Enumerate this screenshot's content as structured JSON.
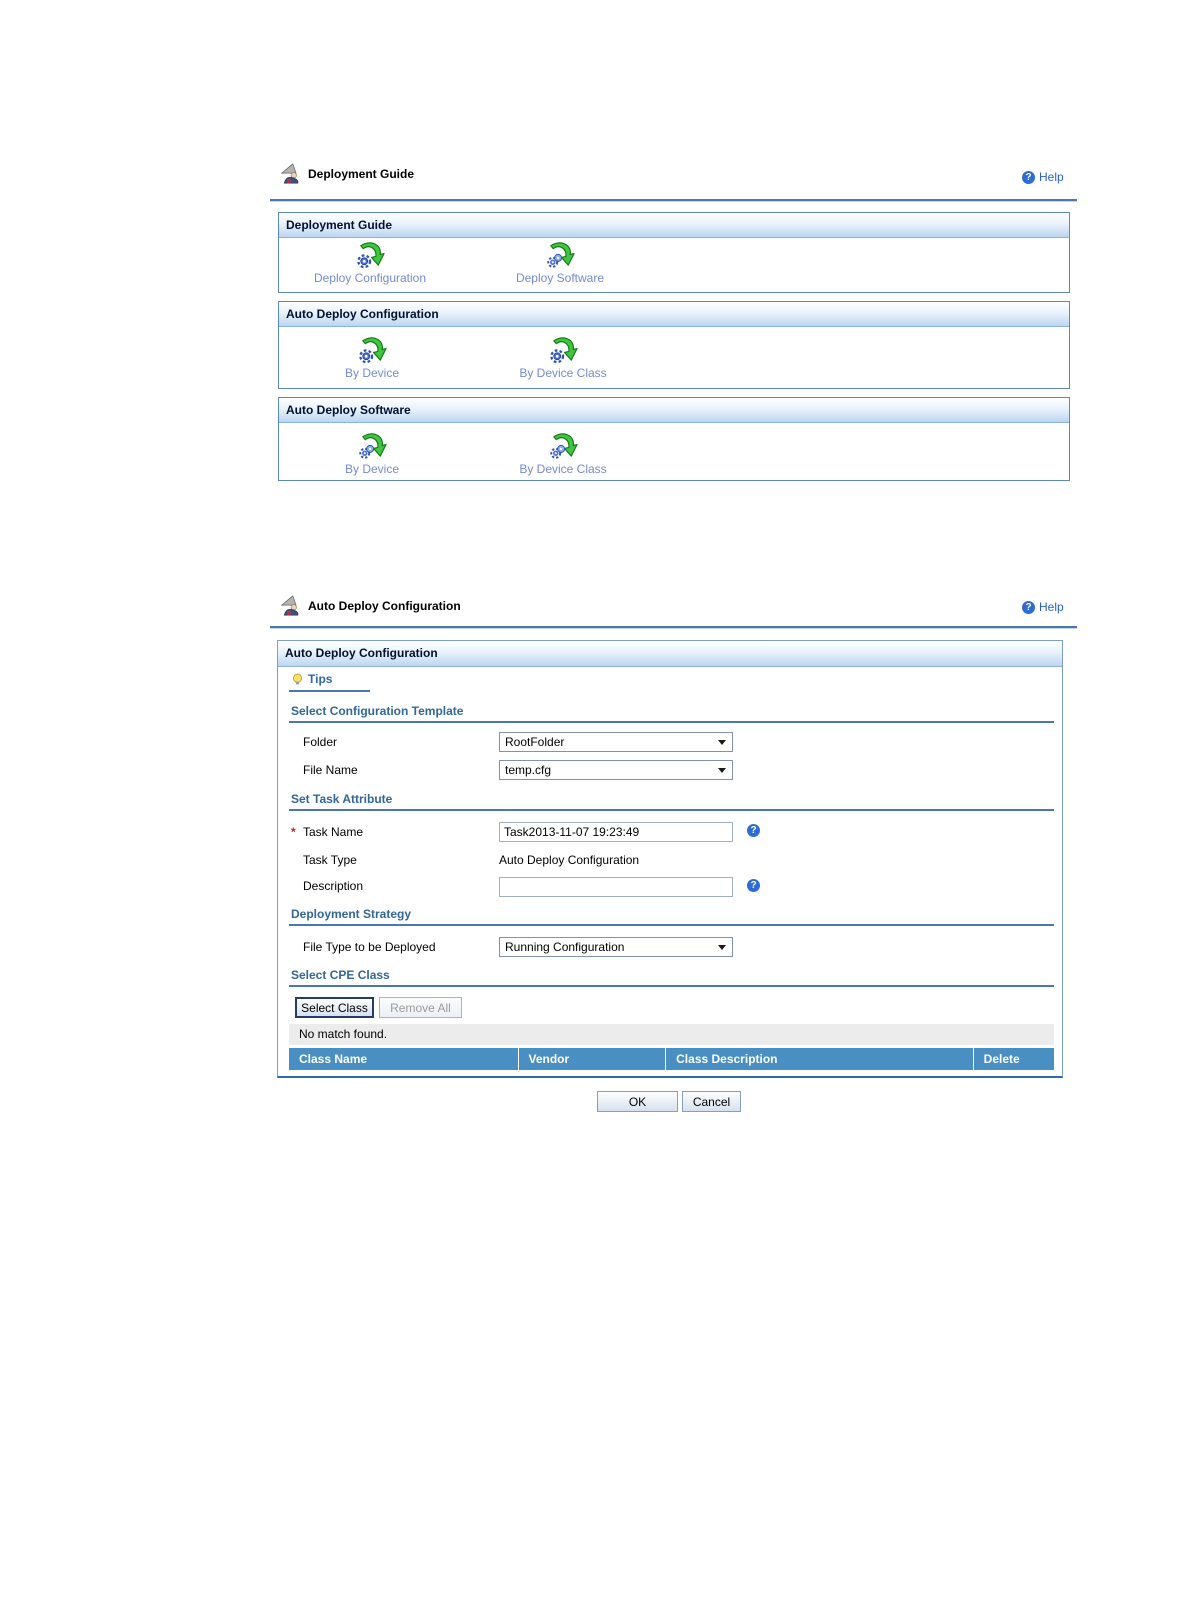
{
  "colors": {
    "accent_rule_blue": "#4c76b2",
    "section_header_gradient_bottom": "#bcd6f0",
    "table_header_bg": "#4a8fc4",
    "launch_link_blue": "#7589d5",
    "heading_blue": "#336699",
    "help_icon_blue": "#2f6bd7",
    "required_red": "#cc2222",
    "notice_bar_gray": "#ececec"
  },
  "screen1": {
    "title": "Deployment Guide",
    "help": "Help",
    "sections": [
      {
        "header": "Deployment Guide",
        "items": [
          {
            "icon": "deploy-configuration-icon",
            "label": "Deploy Configuration"
          },
          {
            "icon": "deploy-software-icon",
            "label": "Deploy Software"
          }
        ]
      },
      {
        "header": "Auto Deploy Configuration",
        "items": [
          {
            "icon": "deploy-configuration-icon",
            "label": "By Device"
          },
          {
            "icon": "deploy-configuration-icon",
            "label": "By Device Class"
          }
        ]
      },
      {
        "header": "Auto Deploy Software",
        "items": [
          {
            "icon": "deploy-software-icon",
            "label": "By Device"
          },
          {
            "icon": "deploy-software-icon",
            "label": "By Device Class"
          }
        ]
      }
    ]
  },
  "screen2": {
    "title": "Auto Deploy Configuration",
    "help": "Help",
    "panel_header": "Auto Deploy Configuration",
    "tips": "Tips",
    "template_section": {
      "heading": "Select Configuration Template",
      "folder_label": "Folder",
      "folder_value": "RootFolder",
      "file_name_label": "File Name",
      "file_name_value": "temp.cfg"
    },
    "task_section": {
      "heading": "Set Task Attribute",
      "required_marker": "*",
      "task_name_label": "Task Name",
      "task_name_value": "Task2013-11-07 19:23:49",
      "task_type_label": "Task Type",
      "task_type_value": "Auto Deploy Configuration",
      "description_label": "Description",
      "description_value": ""
    },
    "strategy_section": {
      "heading": "Deployment Strategy",
      "file_type_label": "File Type to be Deployed",
      "file_type_value": "Running Configuration"
    },
    "cpe_section": {
      "heading": "Select CPE Class",
      "select_class_button": "Select Class",
      "remove_all_button": "Remove All",
      "empty_message": "No match found.",
      "columns": [
        "Class Name",
        "Vendor",
        "Class Description",
        "Delete"
      ]
    },
    "ok_button": "OK",
    "cancel_button": "Cancel"
  }
}
